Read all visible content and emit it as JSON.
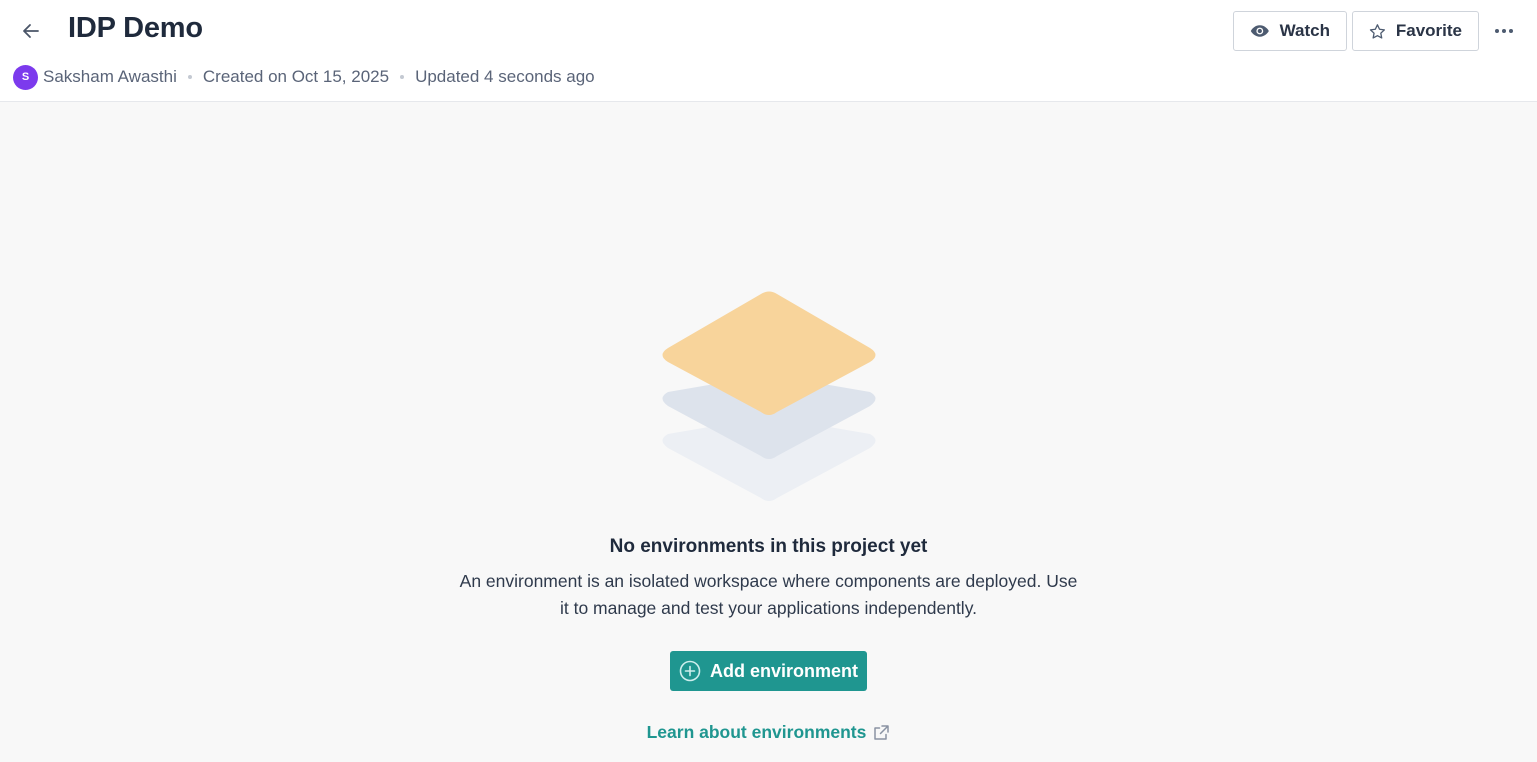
{
  "header": {
    "title": "IDP Demo",
    "avatar_initial": "S",
    "author": "Saksham Awasthi",
    "created": "Created on Oct 15, 2025",
    "updated": "Updated 4 seconds ago",
    "watch_label": "Watch",
    "favorite_label": "Favorite",
    "icons": [
      "arrow-left-icon",
      "eye-icon",
      "star-icon",
      "more-horizontal-icon"
    ]
  },
  "empty_state": {
    "title": "No environments in this project yet",
    "description": "An environment is an isolated workspace where components are deployed. Use it to manage and test your applications independently.",
    "add_button_label": "Add environment",
    "learn_link_label": "Learn about environments",
    "icons": [
      "layers-illustration",
      "plus-circle-icon",
      "external-link-icon"
    ]
  },
  "colors": {
    "accent": "#1f9690",
    "avatar": "#7c3aed",
    "title_text": "#1f2a3c",
    "illustration_top": "#f8d49b",
    "illustration_mid": "#dde3ec",
    "illustration_bottom": "#eceff4"
  }
}
